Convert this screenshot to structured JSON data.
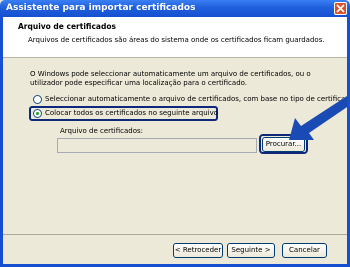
{
  "window": {
    "title": "Assistente para importar certificados"
  },
  "header": {
    "title": "Arquivo de certificados",
    "description": "Arquivos de certificados são áreas do sistema onde os certificados ficam guardados."
  },
  "content": {
    "intro_line1": "O Windows pode seleccionar automaticamente um arquivo de certificados, ou o",
    "intro_line2": "utilizador pode especificar uma localização para o certificado.",
    "option_auto": "Seleccionar automaticamente o arquivo de certificados, com base no tipo de certificado",
    "option_manual": "Colocar todos os certificados no seguinte arquivo",
    "selected_option": "option_manual",
    "store_label": "Arquivo de certificados:",
    "store_value": "",
    "browse_button": "Procurar..."
  },
  "footer": {
    "back_button": "< Retroceder",
    "next_button": "Seguinte >",
    "cancel_button": "Cancelar"
  },
  "colors": {
    "titlebar": "#1f5fdc",
    "highlight": "#10287a",
    "arrow": "#1a4bb5"
  }
}
